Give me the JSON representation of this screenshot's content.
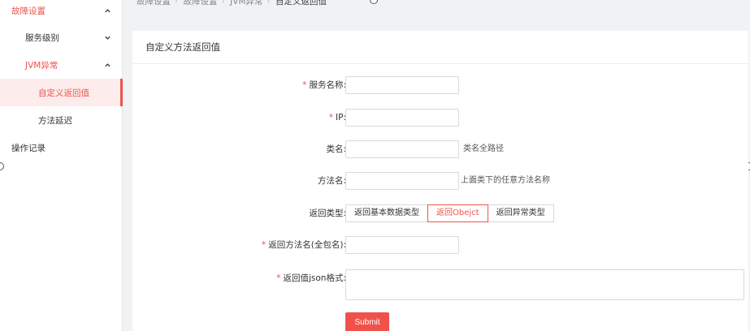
{
  "sidebar": {
    "fault_settings": "故障设置",
    "service_level": "服务级别",
    "jvm_exception": "JVM异常",
    "custom_return": "自定义返回值",
    "method_delay": "方法延迟",
    "operation_log": "操作记录"
  },
  "breadcrumb": {
    "items": [
      "故障设置",
      "故障设置",
      "JVM异常",
      "自定义返回值"
    ],
    "separator": "/"
  },
  "card": {
    "title": "自定义方法返回值"
  },
  "form": {
    "service_name": {
      "label": "服务名称:",
      "value": "",
      "required": true
    },
    "ip": {
      "label": "IP:",
      "value": "",
      "required": true
    },
    "class_name": {
      "label": "类名:",
      "value": "",
      "hint": "类名全路径"
    },
    "method_name": {
      "label": "方法名:",
      "value": "",
      "hint": "上面类下的任意方法名称"
    },
    "return_type": {
      "label": "返回类型:",
      "options": [
        "返回基本数据类型",
        "返回Obejct",
        "返回异常类型"
      ],
      "selected": "返回Obejct"
    },
    "return_method": {
      "label": "返回方法名(全包名):",
      "value": "",
      "required": true
    },
    "return_json": {
      "label": "返回值json格式:",
      "value": "",
      "required": true
    },
    "submit_label": "Submit"
  },
  "colors": {
    "accent": "#f0524b",
    "accent_bg": "#fdecec",
    "page_bg": "#f0f2f5"
  },
  "icons": {
    "fault_settings": "chevron-up-icon",
    "service_level": "chevron-down-icon",
    "jvm_exception": "chevron-up-icon"
  }
}
